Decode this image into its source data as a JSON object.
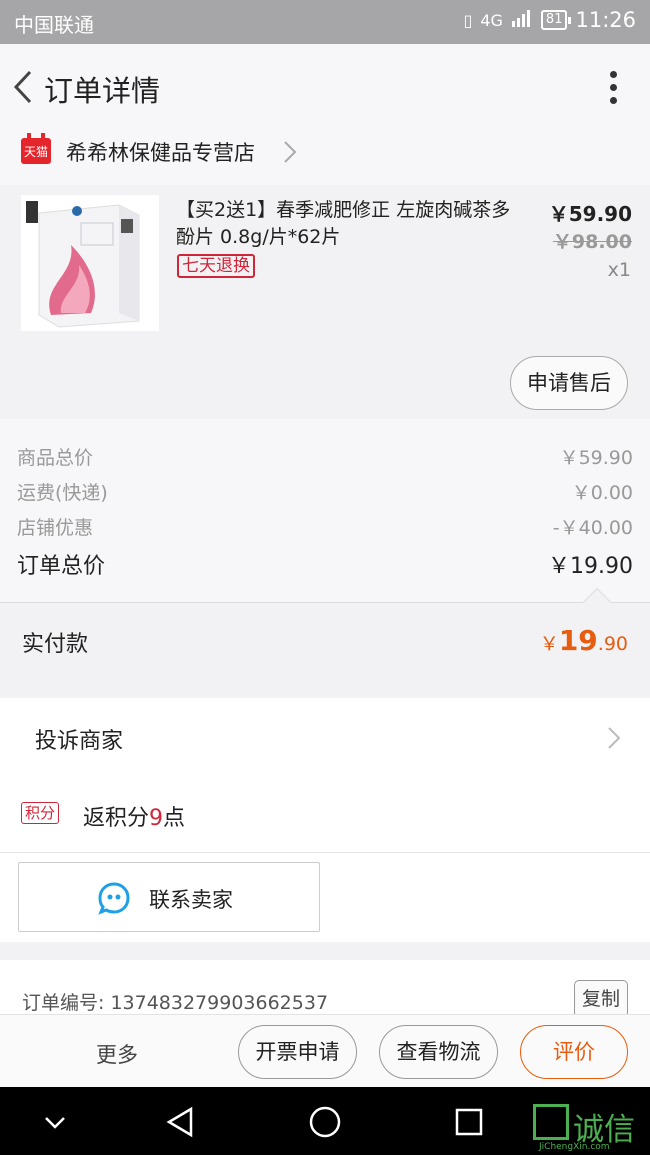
{
  "status_bar": {
    "carrier": "中国联通",
    "network": "4G",
    "battery": "81",
    "time": "11:26"
  },
  "header": {
    "title": "订单详情"
  },
  "shop": {
    "badge": "天猫",
    "name": "希希林保健品专营店"
  },
  "product": {
    "title": "【买2送1】春季减肥修正 左旋肉碱茶多酚片 0.8g/片*62片",
    "tag": "七天退换",
    "price": "￥59.90",
    "original_price": "￥98.00",
    "quantity": "x1",
    "aftersale_label": "申请售后"
  },
  "summary": {
    "rows": [
      {
        "label": "商品总价",
        "value": "￥59.90"
      },
      {
        "label": "运费(快递)",
        "value": "￥0.00"
      },
      {
        "label": "店铺优惠",
        "value": "-￥40.00"
      }
    ],
    "total_label": "订单总价",
    "total_value": "￥19.90"
  },
  "payment": {
    "label": "实付款",
    "currency": "￥",
    "integer": "19",
    "decimal": ".90"
  },
  "complaint": {
    "label": "投诉商家"
  },
  "points": {
    "tag": "积分",
    "prefix": "返积分",
    "number": "9",
    "suffix": "点"
  },
  "contact": {
    "label": "联系卖家"
  },
  "order": {
    "number_text": "订单编号: 137483279903662537",
    "copy_label": "复制"
  },
  "actions": {
    "more": "更多",
    "invoice": "开票申请",
    "logistics": "查看物流",
    "review": "评价"
  },
  "watermark": {
    "text": "诚信",
    "sub": "JiChengXin.com"
  },
  "colors": {
    "accent_orange": "#e85c0f",
    "tmall_red": "#e4252c",
    "tag_red": "#d0263a"
  }
}
